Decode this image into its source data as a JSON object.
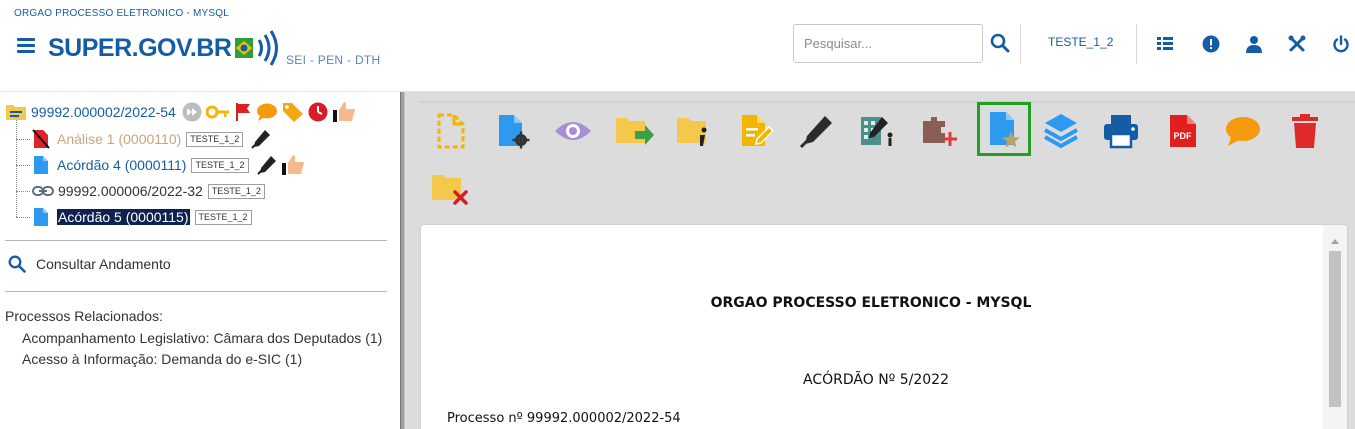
{
  "header": {
    "org_name": "ORGAO PROCESSO ELETRONICO - MYSQL",
    "logo_text_a": "SUPER",
    "logo_text_b": ".GOV.BR",
    "system_name": "SEI - PEN - DTH",
    "search_placeholder": "Pesquisar...",
    "user_unit": "TESTE_1_2",
    "icons": [
      "menu-icon",
      "search-icon",
      "grid-list-icon",
      "alert-icon",
      "user-icon",
      "tools-icon",
      "power-icon"
    ]
  },
  "tree": {
    "root": {
      "label": "99992.000002/2022-54"
    },
    "items": [
      {
        "label": "Análise 1 (0000110)",
        "unit": "TESTE_1_2"
      },
      {
        "label": "Acórdão 4 (0000111)",
        "unit": "TESTE_1_2"
      },
      {
        "label": "99992.000006/2022-32",
        "unit": "TESTE_1_2"
      },
      {
        "label": "Acórdão 5 (0000115)",
        "unit": "TESTE_1_2"
      }
    ]
  },
  "consult_label": "Consultar Andamento",
  "related": {
    "title": "Processos Relacionados:",
    "items": [
      "Acompanhamento Legislativo: Câmara dos Deputados (1)",
      "Acesso à Informação: Demanda do e-SIC (1)"
    ]
  },
  "toolbar": {
    "icons": [
      "new-document-icon",
      "document-settings-icon",
      "view-icon",
      "send-process-icon",
      "process-info-icon",
      "edit-document-icon",
      "sign-icon",
      "block-sign-icon",
      "add-to-block-icon",
      "favorite-document-icon",
      "layers-icon",
      "print-icon",
      "pdf-icon",
      "comment-icon",
      "delete-icon",
      "cancel-process-icon"
    ],
    "pdf_label": "PDF"
  },
  "document": {
    "title": "ORGAO PROCESSO ELETRONICO - MYSQL",
    "subtitle": "ACÓRDÃO Nº 5/2022",
    "process_line": "Processo nº 99992.000002/2022-54"
  },
  "colors": {
    "brand": "#155ca6",
    "selected_bg": "#0d2250",
    "active_outline": "#1ea020"
  }
}
